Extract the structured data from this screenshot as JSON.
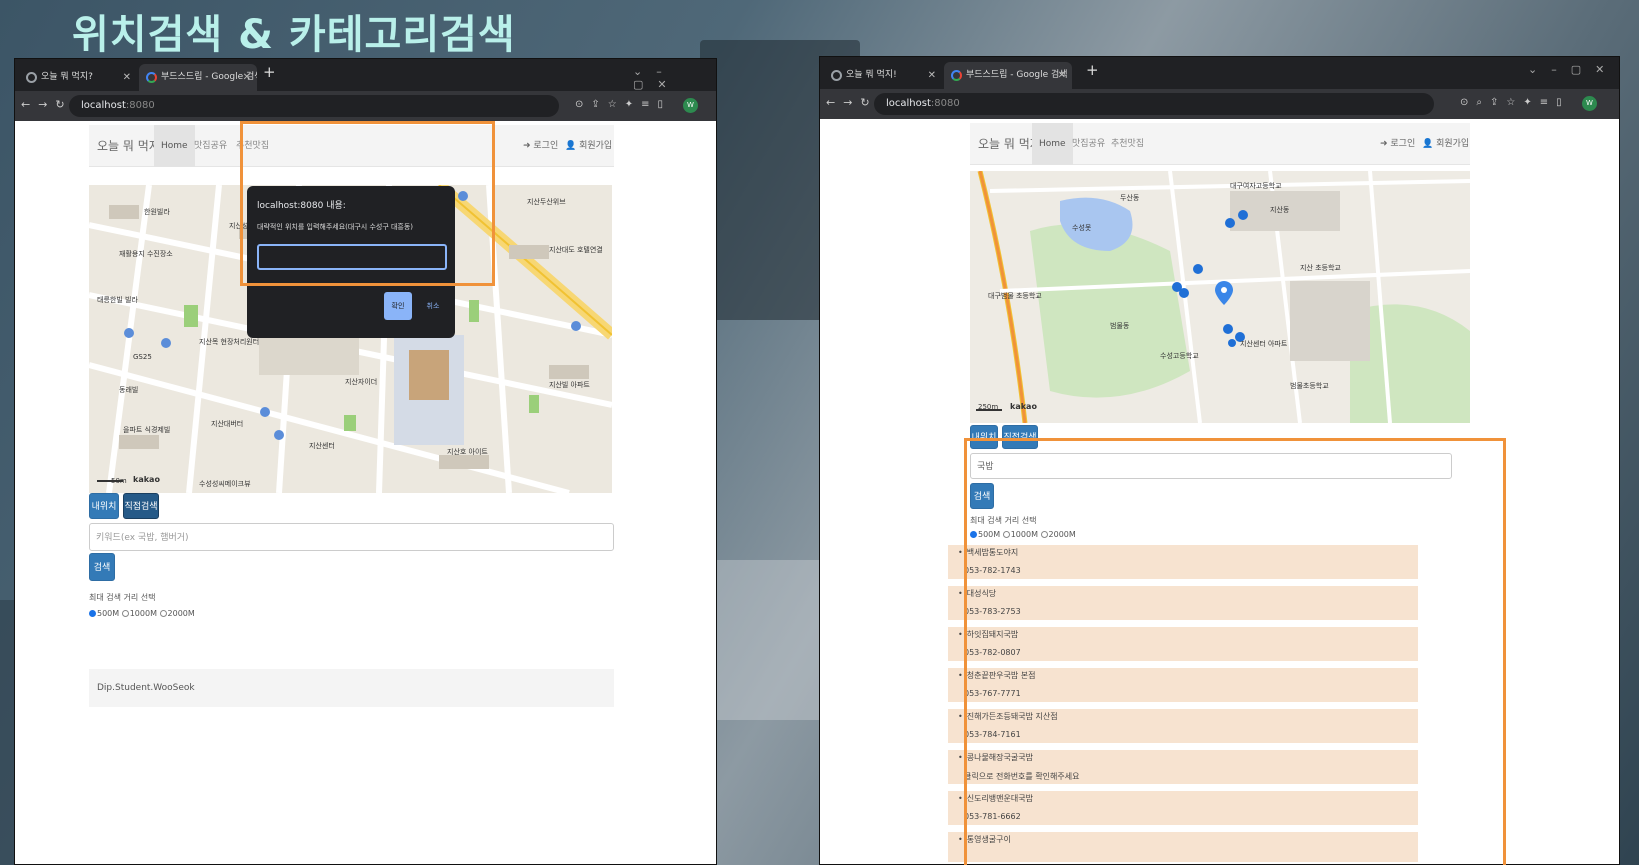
{
  "slide_title": "위치검색 & 카테고리검색",
  "left_window": {
    "tabs": [
      {
        "label": "오늘 뭐 먹지?"
      },
      {
        "label": "부드스드립 - Google 검색"
      }
    ],
    "url": {
      "host": "localhost",
      "port": ":8080"
    },
    "site": {
      "brand": "오늘 뭐 먹지?",
      "nav": [
        "Home",
        "맛집공유",
        "추천맛집"
      ],
      "login": "로그인",
      "signup": "회원가입"
    },
    "map": {
      "labels": [
        "한원빌라",
        "재활용지 수진장소",
        "지산성당 지산동 회미도빌",
        "태릉한빌 빌라",
        "GS25",
        "동래빌",
        "을파트 식경제빌",
        "지산목 현장처리원터",
        "지산대버터",
        "지산자이더",
        "지산두산위브",
        "수성성씨메이크뷰",
        "지산빌 아파트",
        "지산호 아이트",
        "지산센터",
        "지산대도 호텔연결"
      ],
      "scale": "50m",
      "logo": "kakao"
    },
    "dialog": {
      "title": "localhost:8080 내용:",
      "message": "대략적인 위치를 입력해주세요(대구시 수성구 대흥동)",
      "ok": "확인",
      "cancel": "취소"
    },
    "buttons": {
      "my_location": "내위치",
      "direct_search": "직접검색",
      "search": "검색"
    },
    "search": {
      "placeholder": "키워드(ex 국밥, 햄버거)"
    },
    "distance": {
      "label": "최대 검색 거리 선택",
      "options": [
        "500M",
        "1000M",
        "2000M"
      ],
      "selected": "500M"
    },
    "footer": "Dip.Student.WooSeok"
  },
  "right_window": {
    "tabs": [
      {
        "label": "오늘 뭐 먹지!"
      },
      {
        "label": "부드스드립 - Google 검색"
      }
    ],
    "url": {
      "host": "localhost",
      "port": ":8080"
    },
    "site": {
      "brand": "오늘 뭐 먹지?",
      "nav": [
        "Home",
        "맛집공유",
        "추천맛집"
      ],
      "login": "로그인",
      "signup": "회원가입"
    },
    "map": {
      "labels": [
        "수성못",
        "대구여자고등학교",
        "지산동",
        "지산 초등학교",
        "범물동",
        "두산동",
        "지산센터 아파트",
        "수성고등학교",
        "범물초등학교",
        "대구범물 초등학교"
      ],
      "scale": "250m",
      "logo": "kakao"
    },
    "buttons": {
      "my_location": "내위치",
      "direct_search": "직접검색",
      "search": "검색"
    },
    "search": {
      "value": "국밥"
    },
    "distance": {
      "label": "최대 검색 거리 선택",
      "options": [
        "500M",
        "1000M",
        "2000M"
      ],
      "selected": "500M"
    },
    "results": [
      {
        "name": "백세밥통도야지",
        "phone": "053-782-1743"
      },
      {
        "name": "대성식당",
        "phone": "053-783-2753"
      },
      {
        "name": "하잇집돼지국밥",
        "phone": "053-782-0807"
      },
      {
        "name": "청춘끝판우국밥 본점",
        "phone": "053-767-7771"
      },
      {
        "name": "진해가든조등돼국밥 지산점",
        "phone": "053-784-7161"
      },
      {
        "name": "콩나물해장국굴국밥",
        "phone": "클릭으로 전화번호를 확인해주세요"
      },
      {
        "name": "신도리뱅맨운대국밥",
        "phone": "053-781-6662"
      },
      {
        "name": "통영생굴구이",
        "phone": ""
      }
    ]
  },
  "colors": {
    "accent_orange": "#f0923a",
    "bootstrap_blue": "#337ab7",
    "title_mint": "#b9f0ea"
  }
}
